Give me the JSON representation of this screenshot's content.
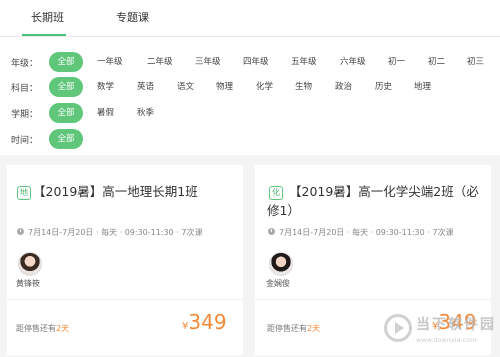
{
  "tabs": [
    "长期班",
    "专题课"
  ],
  "filters": {
    "grade": {
      "label": "年级：",
      "selected": "全部",
      "options": [
        "一年级",
        "二年级",
        "三年级",
        "四年级",
        "五年级",
        "六年级",
        "初一",
        "初二",
        "初三"
      ]
    },
    "subject": {
      "label": "科目：",
      "selected": "全部",
      "options": [
        "数学",
        "英语",
        "语文",
        "物理",
        "化学",
        "生物",
        "政治",
        "历史",
        "地理"
      ]
    },
    "term": {
      "label": "学期：",
      "selected": "全部",
      "options": [
        "暑假",
        "秋季"
      ]
    },
    "time": {
      "label": "时间：",
      "selected": "全部"
    }
  },
  "cards": [
    {
      "badge": "地",
      "title_line1": "【2019暑】高一地理长期1班",
      "title_line2": "",
      "dates": "7月14日-7月20日",
      "freq": "每天",
      "hours": "09:30-11:30",
      "lessons": "7次课",
      "teacher": "黄锋筱",
      "countdown_prefix": "距停售还有",
      "countdown_days": "2天",
      "price_symbol": "¥",
      "price": "349"
    },
    {
      "badge": "化",
      "title_line1": "【2019暑】高一化学尖端2班（必",
      "title_line2": "修1）",
      "dates": "7月14日-7月20日",
      "freq": "每天",
      "hours": "09:30-11:30",
      "lessons": "7次课",
      "teacher": "金娴俊",
      "countdown_prefix": "距停售还有",
      "countdown_days": "2天",
      "price_symbol": "¥",
      "price": "349"
    }
  ],
  "watermark": {
    "text": "当下软件园",
    "url": "www.downxia.com"
  },
  "colors": {
    "accent_green": "#5fc67a",
    "price_orange": "#f08a3a"
  }
}
